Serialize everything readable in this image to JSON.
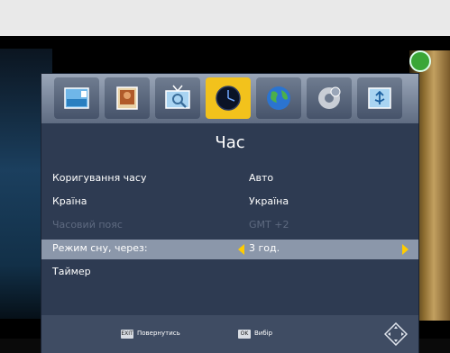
{
  "tabs": [
    {
      "icon": "picture-settings-icon"
    },
    {
      "icon": "photo-icon"
    },
    {
      "icon": "tv-search-icon"
    },
    {
      "icon": "clock-icon",
      "active": true
    },
    {
      "icon": "globe-icon"
    },
    {
      "icon": "settings-gears-icon"
    },
    {
      "icon": "usb-icon"
    }
  ],
  "title": "Час",
  "rows": [
    {
      "label": "Коригування часу",
      "value": "Авто"
    },
    {
      "label": "Країна",
      "value": "Україна"
    },
    {
      "label": "Часовий пояс",
      "value": "GMT +2",
      "disabled": true
    },
    {
      "label": "Режим сну, через:",
      "value": "3 год.",
      "selected": true
    },
    {
      "label": "Таймер",
      "value": ""
    }
  ],
  "footer": {
    "back_key": "EXIT",
    "back_label": "Повернутись",
    "ok_key": "OK",
    "ok_label": "Вибір"
  },
  "colors": {
    "panel": "#2e3b52",
    "highlight": "#8b97aa",
    "active_tab": "#f2c21c",
    "arrow": "#ffcc00"
  }
}
